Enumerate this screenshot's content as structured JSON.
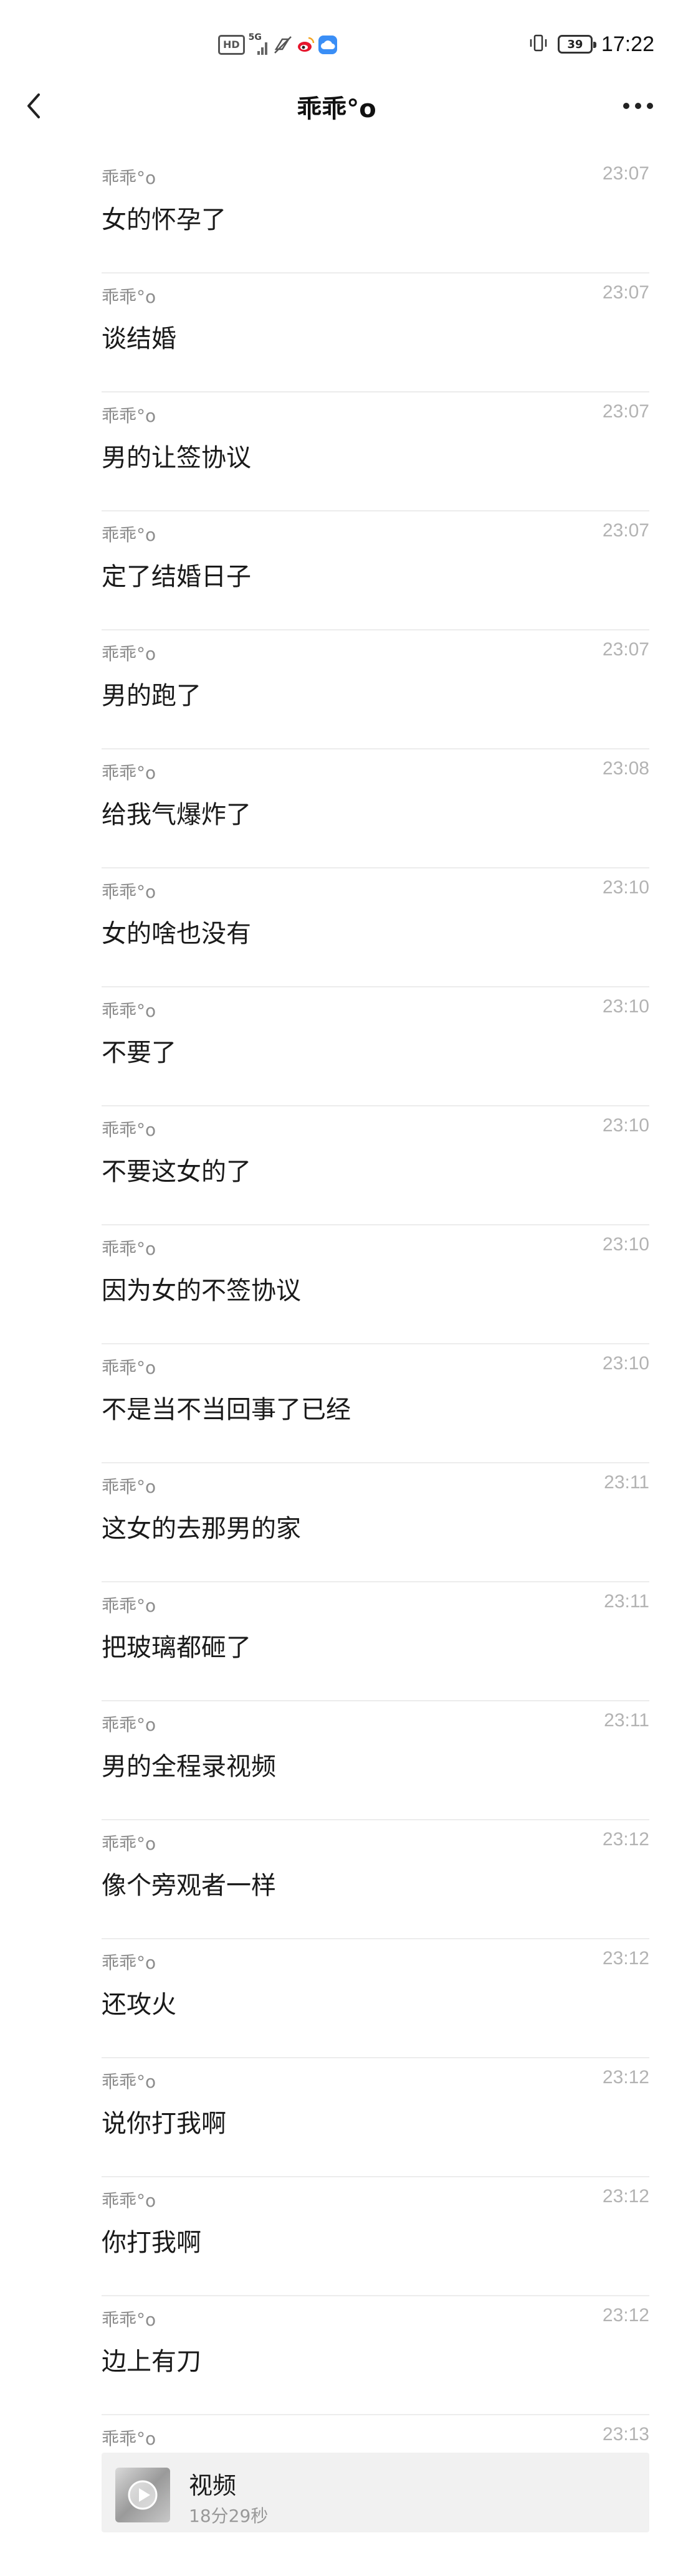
{
  "status_bar": {
    "hd_label": "HD",
    "network_label": "5G",
    "battery_level": "39",
    "time": "17:22"
  },
  "header": {
    "title": "乖乖°o",
    "back_icon": "chevron-left-icon",
    "more_icon": "ellipsis-icon"
  },
  "messages": [
    {
      "sender": "乖乖°o",
      "time": "23:07",
      "text": "女的怀孕了"
    },
    {
      "sender": "乖乖°o",
      "time": "23:07",
      "text": "谈结婚"
    },
    {
      "sender": "乖乖°o",
      "time": "23:07",
      "text": "男的让签协议"
    },
    {
      "sender": "乖乖°o",
      "time": "23:07",
      "text": "定了结婚日子"
    },
    {
      "sender": "乖乖°o",
      "time": "23:07",
      "text": "男的跑了"
    },
    {
      "sender": "乖乖°o",
      "time": "23:08",
      "text": "给我气爆炸了"
    },
    {
      "sender": "乖乖°o",
      "time": "23:10",
      "text": "女的啥也没有"
    },
    {
      "sender": "乖乖°o",
      "time": "23:10",
      "text": "不要了"
    },
    {
      "sender": "乖乖°o",
      "time": "23:10",
      "text": "不要这女的了"
    },
    {
      "sender": "乖乖°o",
      "time": "23:10",
      "text": "因为女的不签协议"
    },
    {
      "sender": "乖乖°o",
      "time": "23:10",
      "text": "不是当不当回事了已经"
    },
    {
      "sender": "乖乖°o",
      "time": "23:11",
      "text": "这女的去那男的家"
    },
    {
      "sender": "乖乖°o",
      "time": "23:11",
      "text": "把玻璃都砸了"
    },
    {
      "sender": "乖乖°o",
      "time": "23:11",
      "text": "男的全程录视频"
    },
    {
      "sender": "乖乖°o",
      "time": "23:12",
      "text": "像个旁观者一样"
    },
    {
      "sender": "乖乖°o",
      "time": "23:12",
      "text": "还攻火"
    },
    {
      "sender": "乖乖°o",
      "time": "23:12",
      "text": "说你打我啊"
    },
    {
      "sender": "乖乖°o",
      "time": "23:12",
      "text": "你打我啊"
    },
    {
      "sender": "乖乖°o",
      "time": "23:12",
      "text": "边上有刀"
    }
  ],
  "video_message": {
    "sender": "乖乖°o",
    "time": "23:13",
    "title": "视频",
    "duration": "18分29秒",
    "play_icon": "play-icon"
  },
  "colors": {
    "background": "#ffffff",
    "text_primary": "#1a1a1a",
    "text_secondary": "#8c8c8c",
    "timestamp": "#b3b3b3",
    "divider": "#ececec",
    "card_background": "#f1f1f1"
  }
}
